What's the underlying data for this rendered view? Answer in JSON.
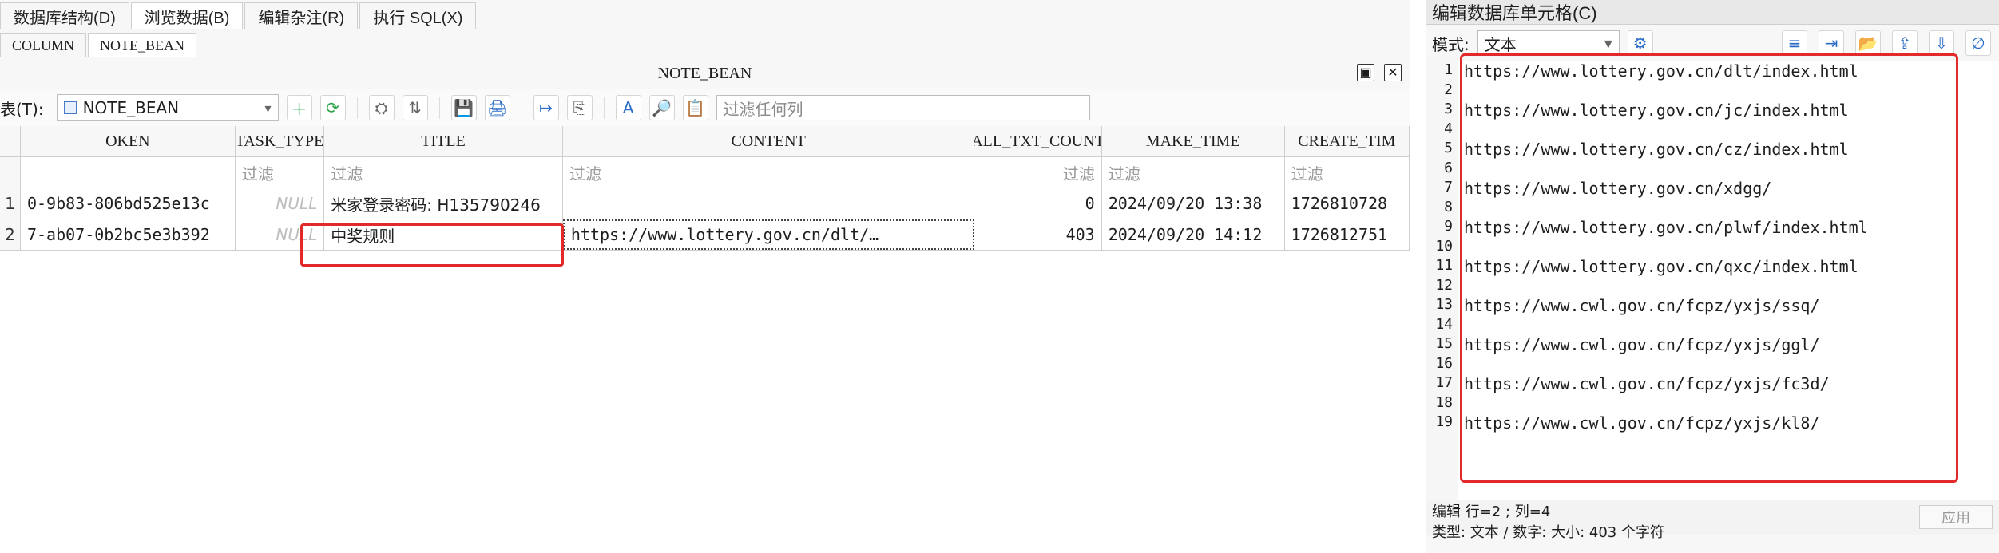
{
  "top_tabs": [
    "数据库结构(D)",
    "浏览数据(B)",
    "编辑杂注(R)",
    "执行 SQL(X)"
  ],
  "sub_tabs": [
    "COLUMN",
    "NOTE_BEAN"
  ],
  "table_title": "NOTE_BEAN",
  "toolbar": {
    "table_label": "表(T):",
    "table_select": "NOTE_BEAN",
    "filter_placeholder": "过滤任何列"
  },
  "grid": {
    "headers": [
      "OKEN",
      "TASK_TYPE",
      "TITLE",
      "CONTENT",
      "ALL_TXT_COUNT",
      "MAKE_TIME",
      "CREATE_TIM"
    ],
    "filter_label": "过滤",
    "rows": [
      {
        "num": "1",
        "token": "0-9b83-806bd525e13c",
        "task_type": "NULL",
        "title": "米家登录密码: H135790246",
        "content": "",
        "all_txt_count": "0",
        "make_time": "2024/09/20 13:38",
        "create_time": "1726810728"
      },
      {
        "num": "2",
        "token": "7-ab07-0b2bc5e3b392",
        "task_type": "NULL",
        "title": "中奖规则",
        "content": "https://www.lottery.gov.cn/dlt/…",
        "all_txt_count": "403",
        "make_time": "2024/09/20 14:12",
        "create_time": "1726812751"
      }
    ]
  },
  "editor": {
    "title": "编辑数据库单元格(C)",
    "mode_label": "模式:",
    "mode_value": "文本",
    "lines": [
      "https://www.lottery.gov.cn/dlt/index.html",
      "",
      "https://www.lottery.gov.cn/jc/index.html",
      "",
      "https://www.lottery.gov.cn/cz/index.html",
      "",
      "https://www.lottery.gov.cn/xdgg/",
      "",
      "https://www.lottery.gov.cn/plwf/index.html",
      "",
      "https://www.lottery.gov.cn/qxc/index.html",
      "",
      "https://www.cwl.gov.cn/fcpz/yxjs/ssq/",
      "",
      "https://www.cwl.gov.cn/fcpz/yxjs/ggl/",
      "",
      "https://www.cwl.gov.cn/fcpz/yxjs/fc3d/",
      "",
      "https://www.cwl.gov.cn/fcpz/yxjs/kl8/"
    ],
    "status_line1": "编辑 行=2 ; 列=4",
    "status_line2": "类型: 文本 / 数字: 大小: 403 个字符",
    "apply_label": "应用"
  },
  "colors": {
    "highlight": "#e32a2a"
  }
}
